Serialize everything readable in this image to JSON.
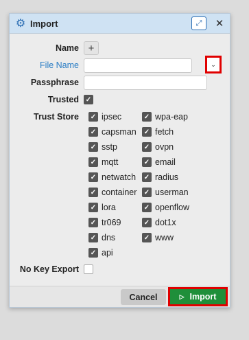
{
  "dialog": {
    "title": "Import",
    "icons": {
      "title": "gear-icon",
      "expand": "expand-icon",
      "close": "close-icon"
    }
  },
  "form": {
    "name_label": "Name",
    "file_name_label": "File Name",
    "file_name_value": "",
    "passphrase_label": "Passphrase",
    "passphrase_value": "",
    "trusted_label": "Trusted",
    "trusted_checked": true,
    "trust_store_label": "Trust Store",
    "trust_store_col1": [
      {
        "label": "ipsec",
        "checked": true
      },
      {
        "label": "capsman",
        "checked": true
      },
      {
        "label": "sstp",
        "checked": true
      },
      {
        "label": "mqtt",
        "checked": true
      },
      {
        "label": "netwatch",
        "checked": true
      },
      {
        "label": "container",
        "checked": true
      },
      {
        "label": "lora",
        "checked": true
      },
      {
        "label": "tr069",
        "checked": true
      },
      {
        "label": "dns",
        "checked": true
      },
      {
        "label": "api",
        "checked": true
      }
    ],
    "trust_store_col2": [
      {
        "label": "wpa-eap",
        "checked": true
      },
      {
        "label": "fetch",
        "checked": true
      },
      {
        "label": "ovpn",
        "checked": true
      },
      {
        "label": "email",
        "checked": true
      },
      {
        "label": "radius",
        "checked": true
      },
      {
        "label": "userman",
        "checked": true
      },
      {
        "label": "openflow",
        "checked": true
      },
      {
        "label": "dot1x",
        "checked": true
      },
      {
        "label": "www",
        "checked": true
      }
    ],
    "no_key_export_label": "No Key Export",
    "no_key_export_checked": false
  },
  "footer": {
    "cancel_label": "Cancel",
    "import_label": "Import"
  },
  "colors": {
    "accent": "#2b6db3",
    "import_button": "#1f8f3a",
    "highlight": "#e00000"
  }
}
